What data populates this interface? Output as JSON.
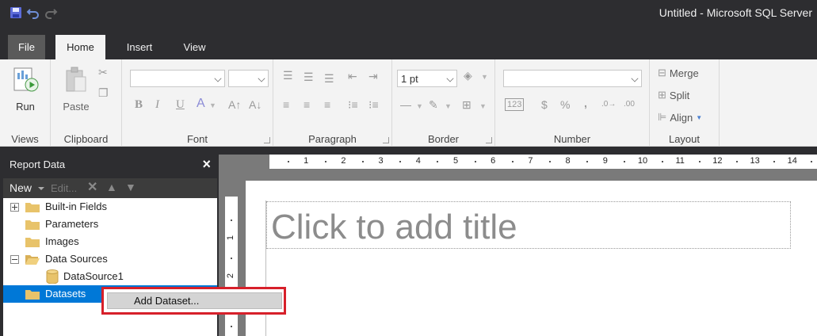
{
  "window": {
    "title": "Untitled - Microsoft SQL Server"
  },
  "quick_access": [
    {
      "icon": "save-icon"
    },
    {
      "icon": "undo-icon"
    },
    {
      "icon": "redo-icon"
    }
  ],
  "tabs": [
    {
      "label": "File"
    },
    {
      "label": "Home"
    },
    {
      "label": "Insert"
    },
    {
      "label": "View"
    }
  ],
  "ribbon": {
    "views": {
      "label": "Views",
      "run_label": "Run"
    },
    "clipboard": {
      "label": "Clipboard",
      "paste_label": "Paste"
    },
    "font": {
      "label": "Font",
      "bold": "B",
      "italic": "I",
      "underline": "U",
      "font_color": "A"
    },
    "paragraph": {
      "label": "Paragraph"
    },
    "border": {
      "label": "Border",
      "width_value": "1 pt"
    },
    "number": {
      "label": "Number",
      "currency": "$",
      "percent": "%",
      "comma": ",",
      "placeholder_glyph": "123"
    },
    "layout": {
      "label": "Layout",
      "merge_label": "Merge",
      "split_label": "Split",
      "align_label": "Align"
    }
  },
  "report_data": {
    "title": "Report Data",
    "close": "×",
    "toolbar": {
      "new_label": "New",
      "edit_label": "Edit..."
    },
    "tree": [
      {
        "label": "Built-in Fields",
        "expander": "plus"
      },
      {
        "label": "Parameters"
      },
      {
        "label": "Images"
      },
      {
        "label": "Data Sources",
        "expander": "minus"
      },
      {
        "label": "DataSource1",
        "kind": "datasource"
      },
      {
        "label": "Datasets",
        "selected": true
      }
    ]
  },
  "context_menu": {
    "add_dataset_label": "Add Dataset..."
  },
  "design": {
    "title_placeholder": "Click to add title",
    "ruler_h": [
      "1",
      "2",
      "3",
      "4",
      "5",
      "6",
      "7",
      "8",
      "9",
      "10",
      "11",
      "12",
      "13",
      "14"
    ],
    "ruler_v": [
      "1",
      "2"
    ]
  },
  "colors": {
    "chrome_dark": "#2d2d30",
    "ribbon_bg": "#f3f3f3",
    "selection_blue": "#0078d7",
    "highlight_red": "#d7202a",
    "folder_yellow": "#e8c36a"
  }
}
